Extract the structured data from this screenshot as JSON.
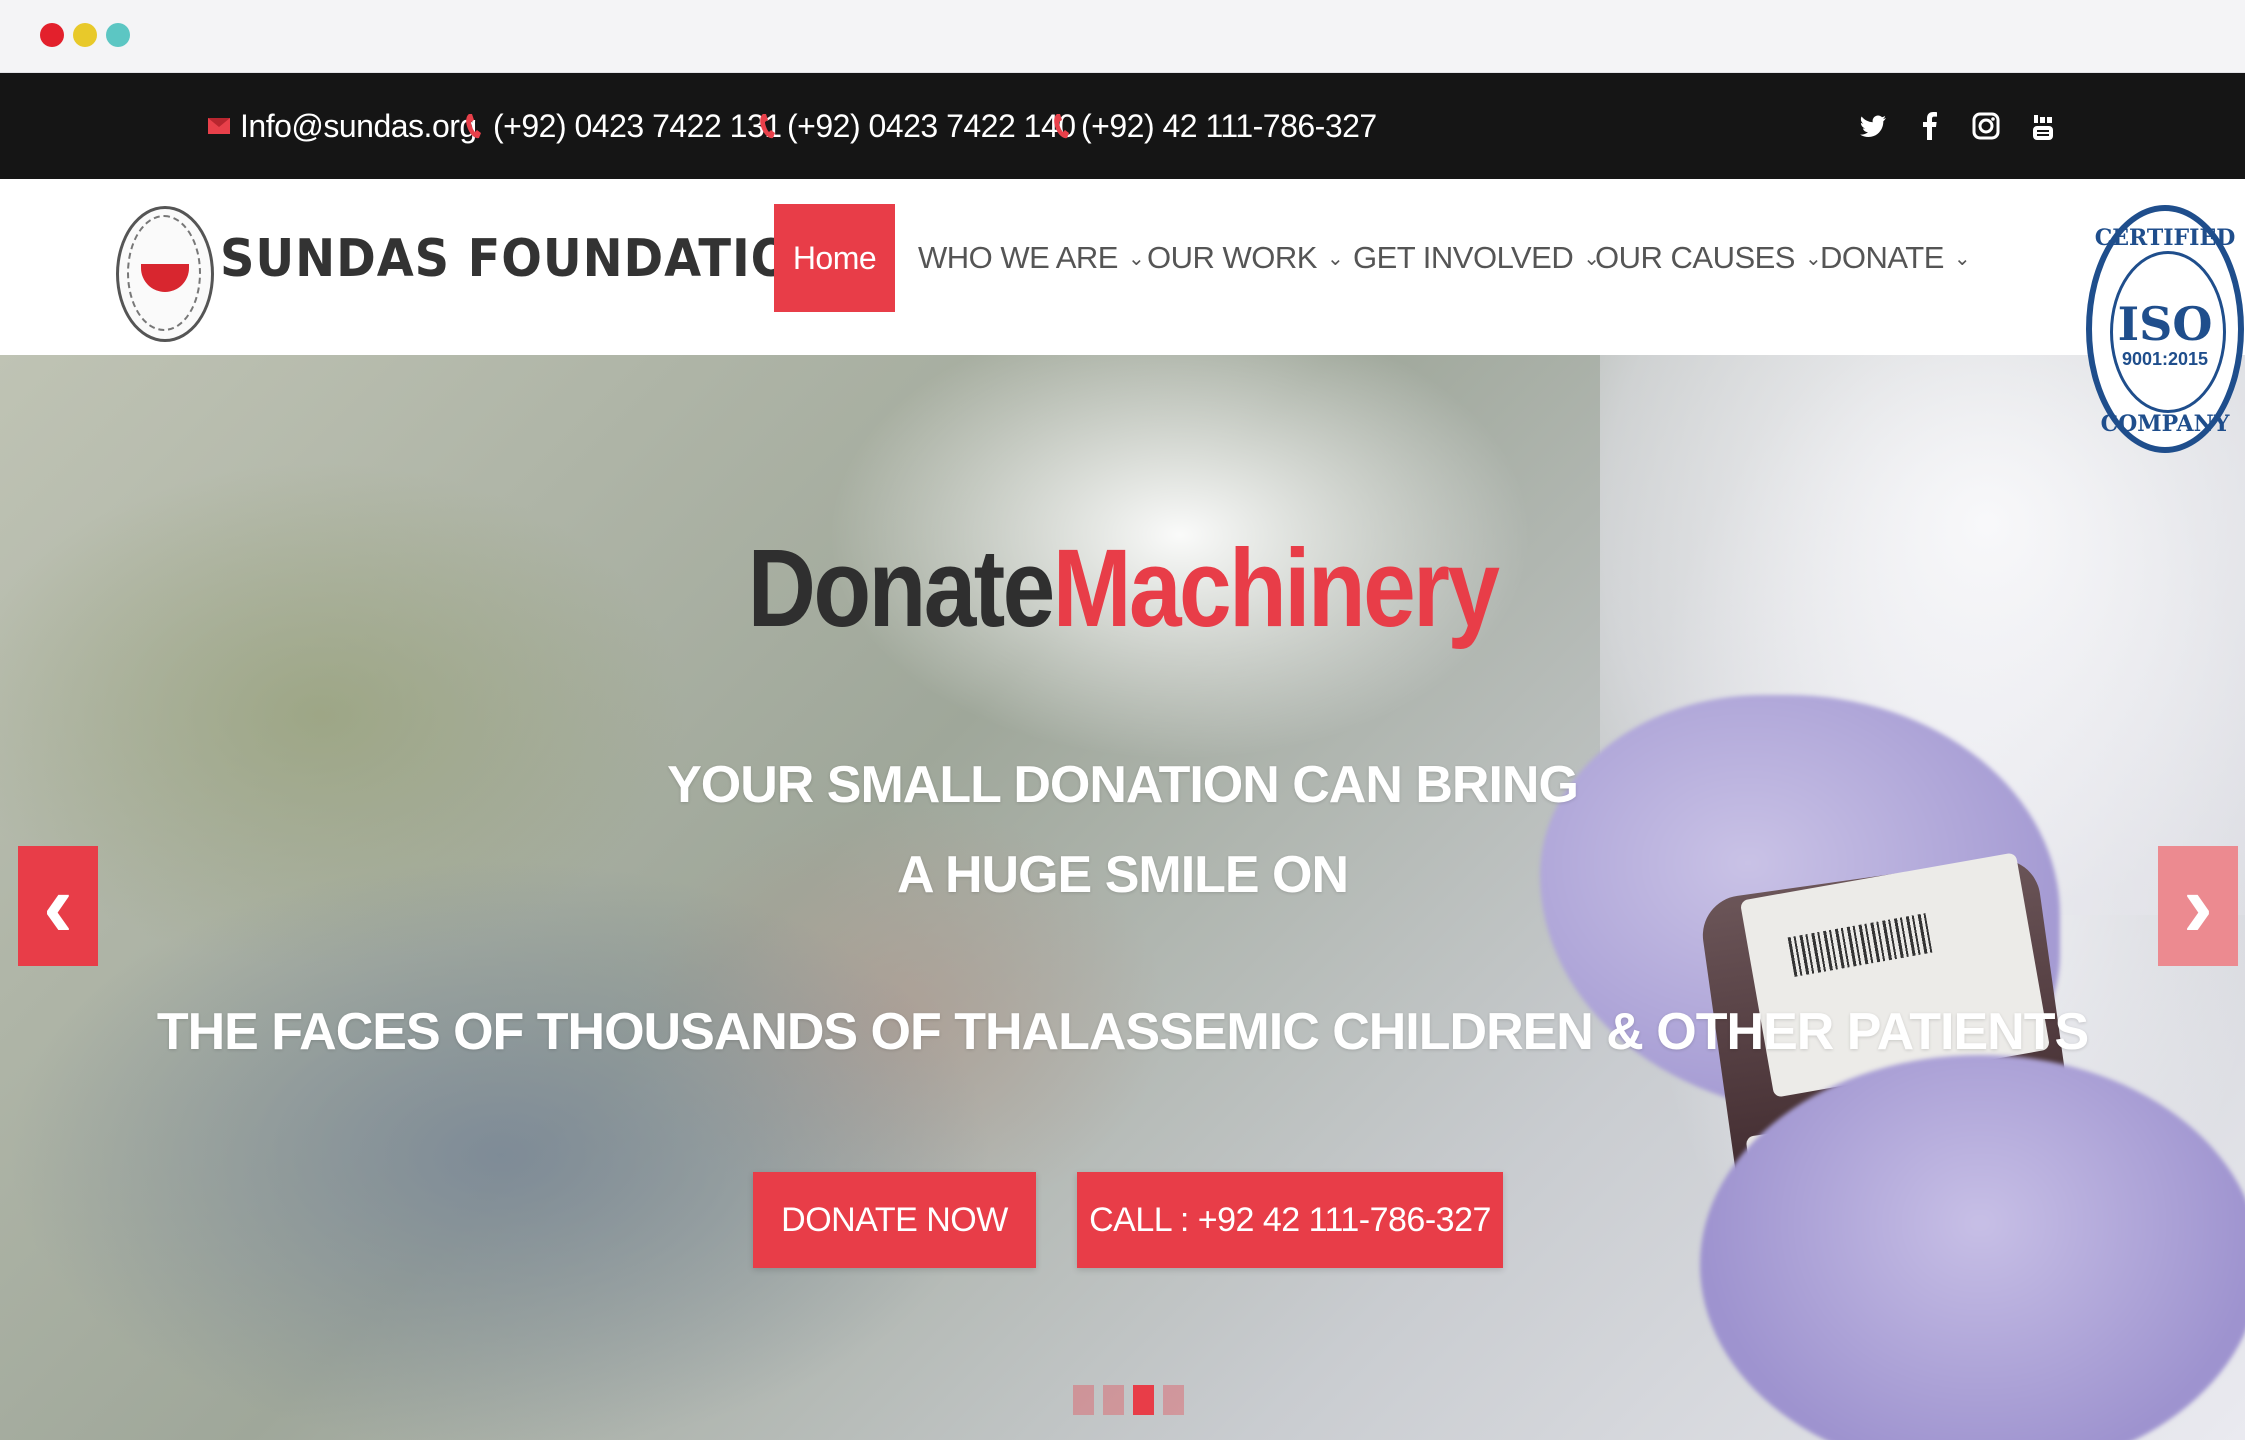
{
  "topbar": {
    "email": "Info@sundas.org",
    "phones": [
      "(+92) 0423 7422 131",
      "(+92) 0423 7422 140",
      "(+92) 42 111-786-327"
    ],
    "social_icons": [
      "twitter-icon",
      "facebook-icon",
      "instagram-icon",
      "youtube-icon"
    ]
  },
  "brand": {
    "name": "SUNDAS FOUNDATION"
  },
  "nav": {
    "home": "Home",
    "items": [
      "WHO WE ARE",
      "OUR WORK",
      "GET INVOLVED",
      "OUR CAUSES",
      "DONATE"
    ]
  },
  "iso_badge": {
    "top": "CERTIFIED",
    "main": "ISO",
    "standard": "9001:2015",
    "bottom": "COMPANY"
  },
  "hero": {
    "title_dark": "Donate",
    "title_red": "Machinery",
    "line1": "YOUR SMALL DONATION CAN BRING",
    "line2": "A HUGE SMILE ON",
    "line3": "THE FACES OF THOUSANDS OF THALASSEMIC CHILDREN & OTHER PATIENTS",
    "donate_button": "DONATE NOW",
    "call_button": "CALL : +92 42 111-786-327",
    "slide_count": 4,
    "active_slide": 3
  },
  "colors": {
    "accent": "#e83d48",
    "topbar": "#151515",
    "iso_blue": "#1f4e8c"
  }
}
